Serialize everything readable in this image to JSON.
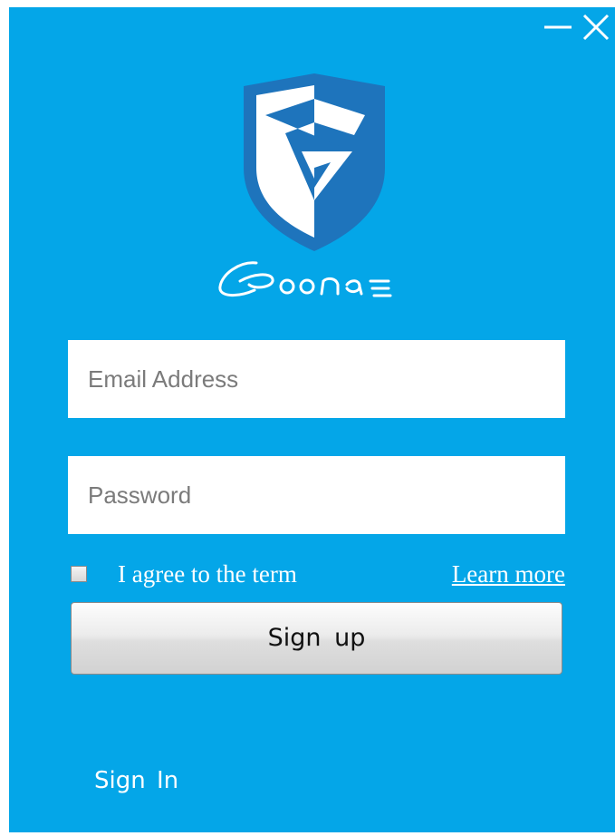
{
  "window": {
    "background_color": "#04a6e8",
    "minimize_icon": "minimize-icon",
    "close_icon": "close-icon"
  },
  "brand": {
    "logo_icon": "shield-g-logo",
    "wordmark": "Goonas",
    "colors": {
      "shield_dark": "#1e74bc",
      "shield_light": "#ffffff"
    }
  },
  "form": {
    "email": {
      "placeholder": "Email Address",
      "value": ""
    },
    "password": {
      "placeholder": "Password",
      "value": ""
    },
    "agree": {
      "label": "I agree to the term",
      "checked": false
    },
    "learn_more": "Learn more",
    "signup_label": "Sign  up"
  },
  "footer": {
    "signin_label": "Sign  In"
  }
}
